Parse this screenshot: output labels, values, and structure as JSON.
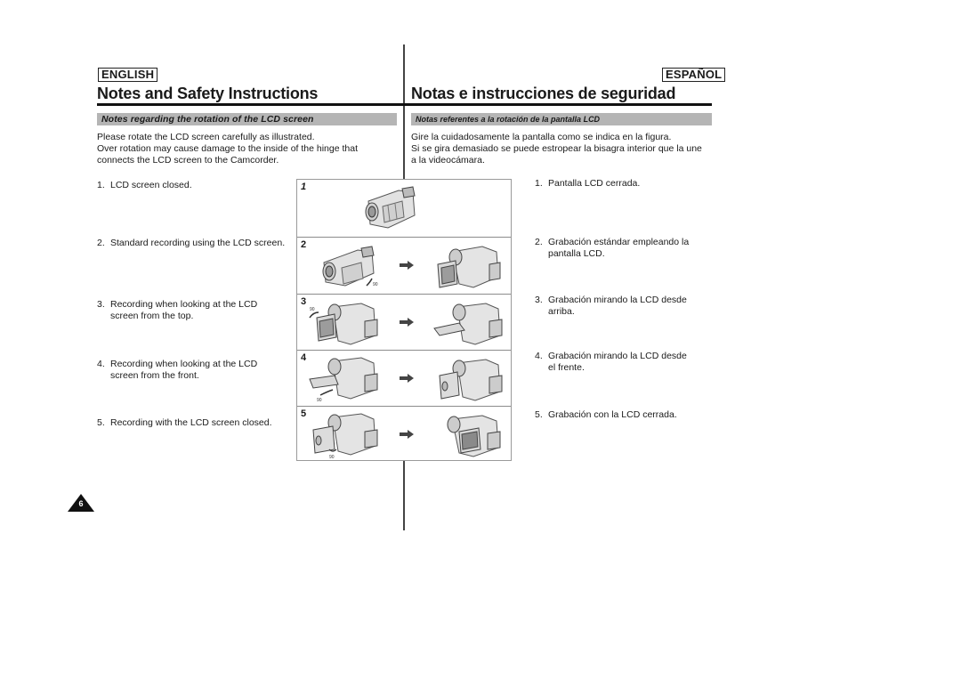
{
  "english": {
    "language_label": "ENGLISH",
    "title": "Notes and Safety Instructions",
    "subheading": "Notes regarding the rotation of the LCD screen",
    "intro": [
      "Please rotate the LCD screen carefully as illustrated.",
      "Over rotation may cause damage to the inside of the hinge that",
      "connects the LCD screen to the Camcorder."
    ],
    "items": [
      {
        "num": "1.",
        "lines": [
          "LCD screen closed."
        ]
      },
      {
        "num": "2.",
        "lines": [
          "Standard recording using the LCD screen."
        ]
      },
      {
        "num": "3.",
        "lines": [
          "Recording when looking at the LCD",
          "screen from the top."
        ]
      },
      {
        "num": "4.",
        "lines": [
          "Recording when looking at the LCD",
          "screen from the front."
        ]
      },
      {
        "num": "5.",
        "lines": [
          "Recording with the LCD screen closed."
        ]
      }
    ]
  },
  "spanish": {
    "language_label": "ESPAÑOL",
    "title": "Notas e instrucciones de seguridad",
    "subheading": "Notas referentes a la rotación de la pantalla LCD",
    "intro": [
      "Gire la cuidadosamente la pantalla como se indica en la figura.",
      "Si se gira demasiado se puede estropear la bisagra interior que la une",
      "a la videocámara."
    ],
    "items": [
      {
        "num": "1.",
        "lines": [
          "Pantalla LCD cerrada."
        ]
      },
      {
        "num": "2.",
        "lines": [
          "Grabación estándar empleando la",
          "pantalla LCD."
        ]
      },
      {
        "num": "3.",
        "lines": [
          "Grabación mirando la LCD desde",
          "arriba."
        ]
      },
      {
        "num": "4.",
        "lines": [
          "Grabación mirando la LCD desde",
          "el frente."
        ]
      },
      {
        "num": "5.",
        "lines": [
          "Grabación con la LCD cerrada."
        ]
      }
    ]
  },
  "figure": {
    "rows": [
      {
        "label": "1",
        "panels": [
          "camcorder-closed"
        ]
      },
      {
        "label": "2",
        "panels": [
          "camcorder-closed",
          "camcorder-lcd-open"
        ],
        "rotation_mark": "90"
      },
      {
        "label": "3",
        "panels": [
          "camcorder-lcd-open",
          "camcorder-lcd-tilted-up"
        ],
        "rotation_mark": "90"
      },
      {
        "label": "4",
        "panels": [
          "camcorder-lcd-tilted-down",
          "camcorder-lcd-front"
        ],
        "rotation_mark": "90"
      },
      {
        "label": "5",
        "panels": [
          "camcorder-lcd-reversed",
          "camcorder-lcd-closed-facing-out"
        ],
        "rotation_mark": "90"
      }
    ]
  },
  "page_number": "6"
}
